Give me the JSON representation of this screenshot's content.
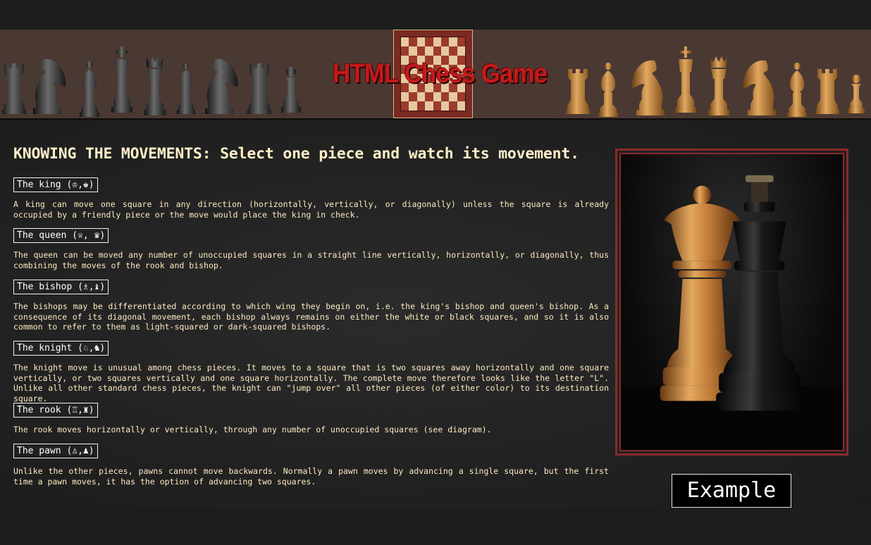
{
  "header": {
    "title": "HTML Chess Game"
  },
  "main": {
    "heading": "KNOWING THE MOVEMENTS: Select one piece and watch its movement.",
    "pieces": [
      {
        "label": "The king (♔,♚)",
        "description": "A king can move one square in any direction (horizontally, vertically, or diagonally) unless the square is already occupied by a friendly piece or the move would place the king in check."
      },
      {
        "label": "The queen (♕, ♛)",
        "description": "The queen can be moved any number of unoccupied squares in a straight line vertically, horizontally, or diagonally, thus combining the moves of the rook and bishop."
      },
      {
        "label": "The bishop (♗,♝)",
        "description": "The bishops may be differentiated according to which wing they begin on, i.e. the king's bishop and queen's bishop. As a consequence of its diagonal movement, each bishop always remains on either the white or black squares, and so it is also common to refer to them as light-squared or dark-squared bishops."
      },
      {
        "label": "The knight (♘,♞)",
        "description": "The knight move is unusual among chess pieces. It moves to a square that is two squares away horizontally and one square vertically, or two squares vertically and one square horizontally. The complete move therefore looks like the letter \"L\". Unlike all other standard chess pieces, the knight can \"jump over\" all other pieces (of either color) to its destination square."
      },
      {
        "label": "The rook (♖,♜)",
        "description": "The rook moves horizontally or vertically, through any number of unoccupied squares (see diagram)."
      },
      {
        "label": "The pawn (♙,♟)",
        "description": "Unlike the other pieces, pawns cannot move backwards. Normally a pawn moves by advancing a single square, but the first time a pawn moves, it has the option of advancing two squares."
      }
    ],
    "example_button": "Example"
  },
  "colors": {
    "banner_bg": "#4a3932",
    "title_red": "#c41a1a",
    "text_cream": "#fde9c0",
    "frame_red": "#8a2a2a",
    "dark_piece": "#2a2a2a",
    "light_piece": "#c98a3e"
  },
  "icons": {
    "banner_left": [
      "rook-icon",
      "knight-icon",
      "bishop-icon",
      "king-icon",
      "queen-icon",
      "bishop-icon",
      "knight-icon",
      "rook-icon",
      "pawn-icon"
    ],
    "banner_right": [
      "rook-icon",
      "bishop-icon",
      "knight-icon",
      "king-icon",
      "queen-icon",
      "knight-icon",
      "bishop-icon",
      "rook-icon",
      "pawn-icon"
    ]
  }
}
